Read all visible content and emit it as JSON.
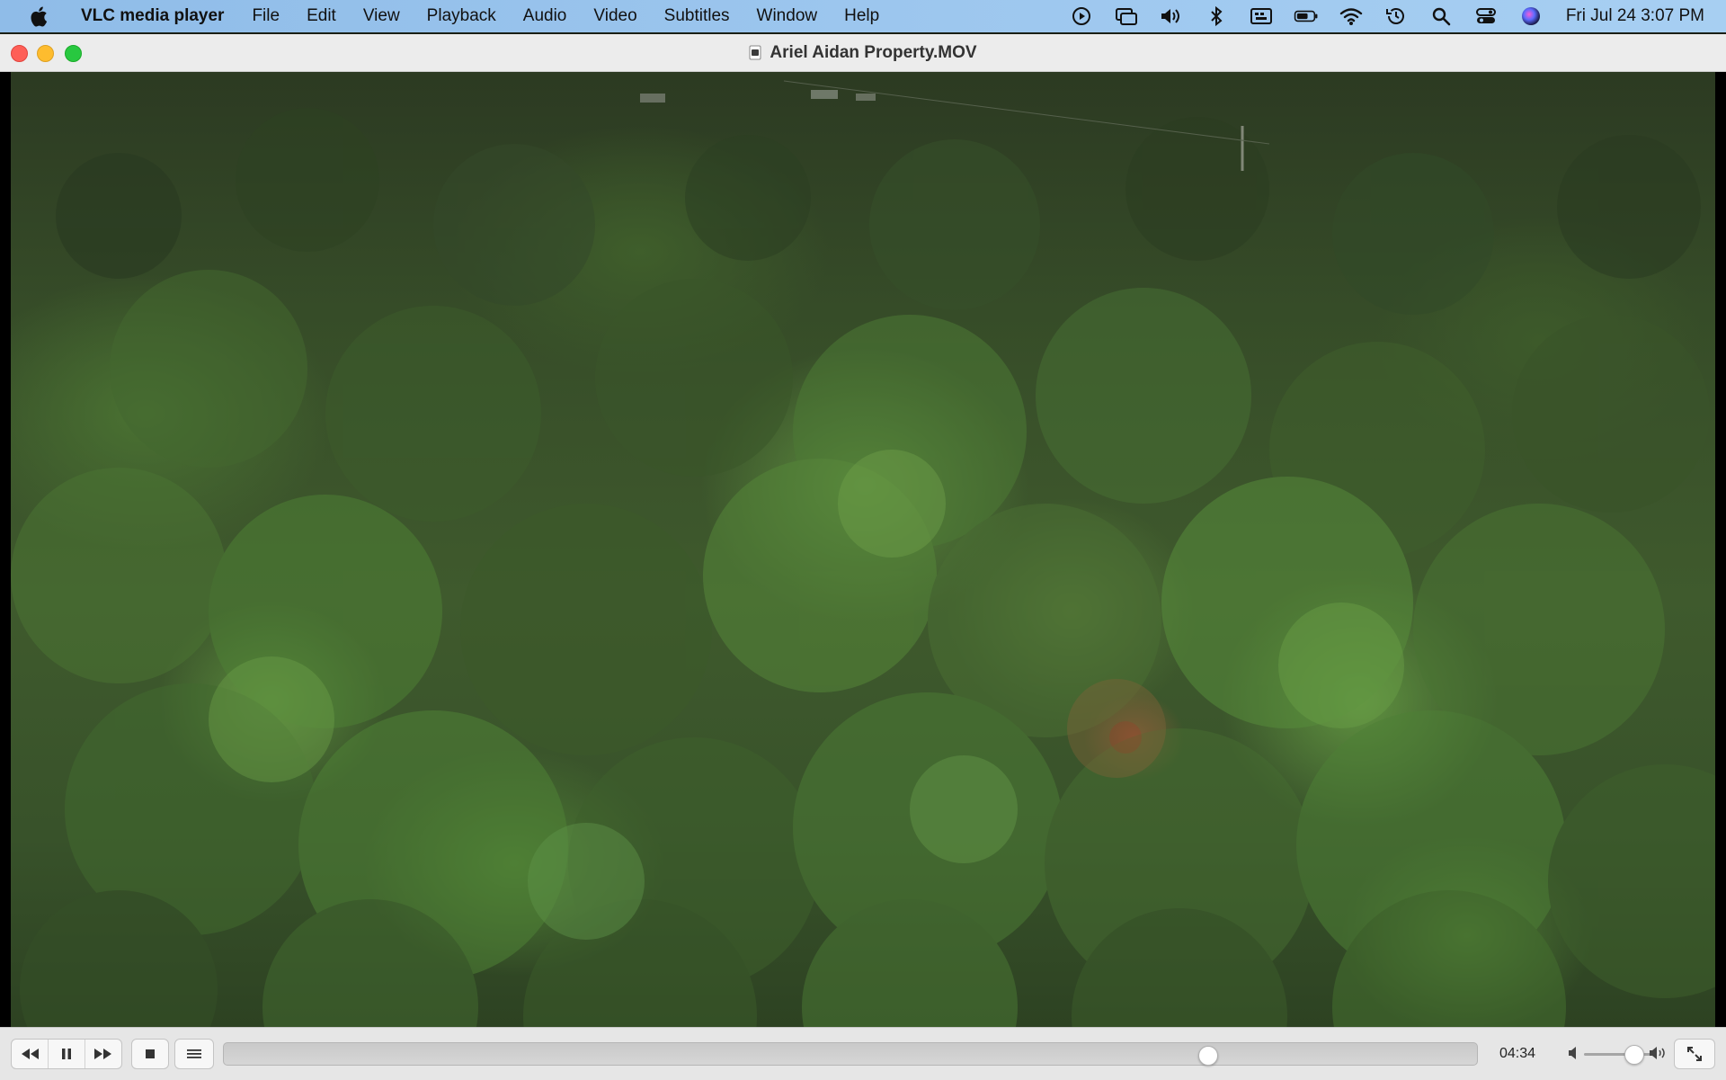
{
  "menubar": {
    "app_name": "VLC media player",
    "items": [
      "File",
      "Edit",
      "View",
      "Playback",
      "Audio",
      "Video",
      "Subtitles",
      "Window",
      "Help"
    ],
    "clock": "Fri Jul 24  3:07 PM",
    "status_icons": [
      "play-circle-icon",
      "screen-mirroring-icon",
      "volume-icon",
      "bluetooth-icon",
      "keyboard-input-icon",
      "battery-icon",
      "wifi-icon",
      "time-machine-icon",
      "spotlight-search-icon",
      "control-center-icon",
      "siri-icon"
    ]
  },
  "window": {
    "title": "Ariel Aidan Property.MOV",
    "accent_colors": {
      "close": "#fe5f57",
      "minimize": "#febc2e",
      "maximize": "#28c840"
    }
  },
  "player": {
    "elapsed_time": "04:34",
    "playback_progress": 0.785,
    "volume_level": 0.7,
    "buttons": [
      "rewind-icon",
      "pause-icon",
      "fast-forward-icon",
      "stop-icon",
      "playlist-icon",
      "fullscreen-icon"
    ]
  }
}
